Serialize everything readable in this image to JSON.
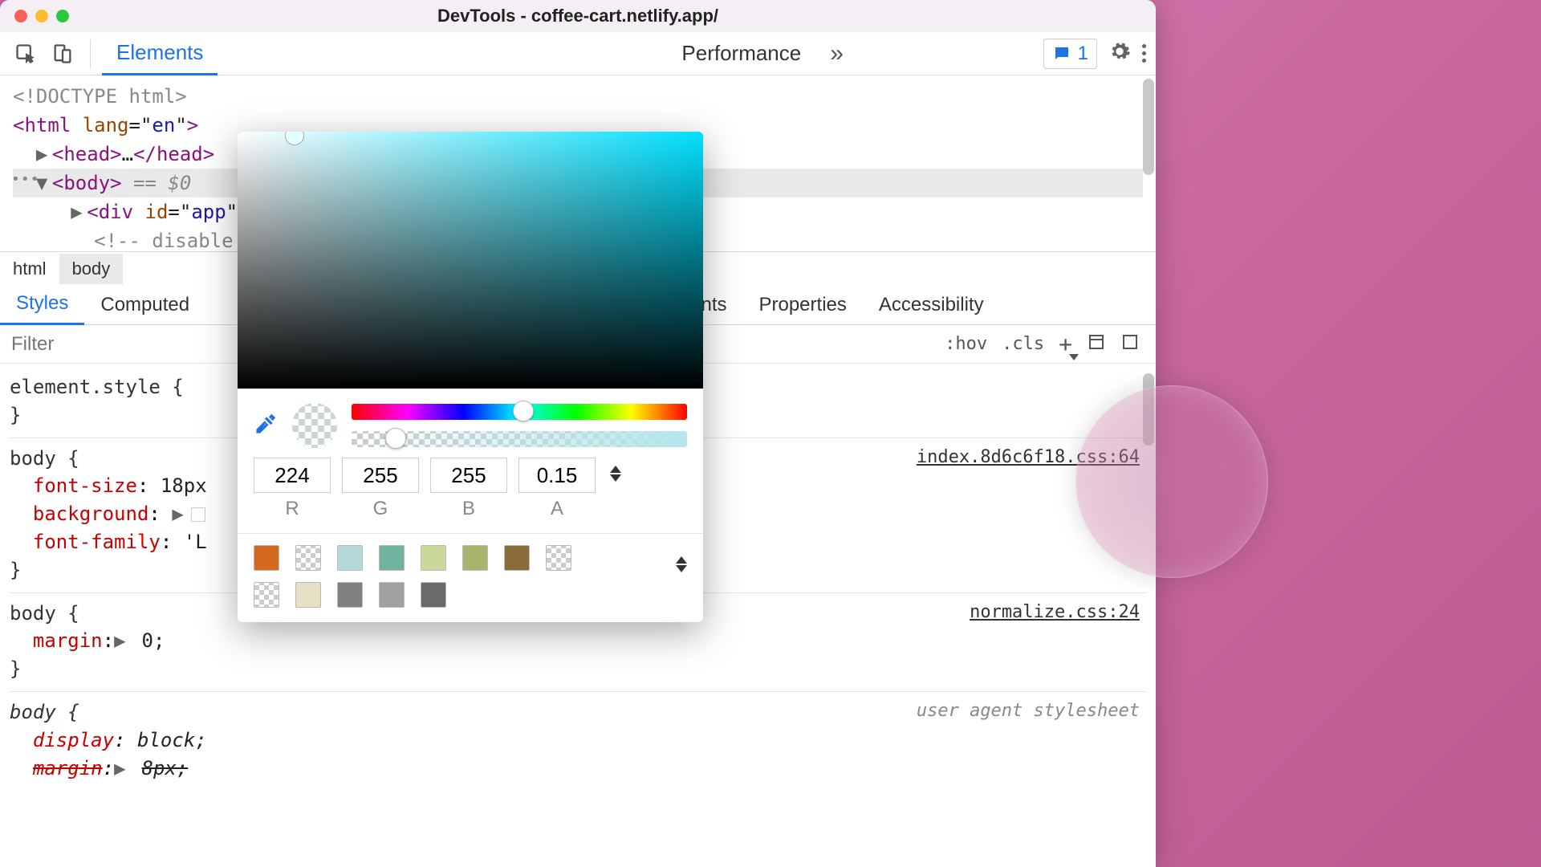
{
  "window": {
    "title": "DevTools - coffee-cart.netlify.app/"
  },
  "toolbar": {
    "tabs": [
      "Elements",
      "Performance"
    ],
    "more_glyph": "»",
    "issue_count": "1"
  },
  "dom": {
    "doctype": "<!DOCTYPE html>",
    "html_open": "<html lang=\"en\">",
    "head": "<head>…</head>",
    "body": "<body>",
    "body_sel": " == $0",
    "div": "<div id=\"app\"",
    "comment": "<!-- disable",
    "comment_close": ">"
  },
  "crumbs": [
    "html",
    "body"
  ],
  "styles": {
    "tabs": [
      "Styles",
      "Computed",
      "akpoints",
      "Properties",
      "Accessibility"
    ],
    "filter_placeholder": "Filter",
    "hov": ":hov",
    "cls": ".cls",
    "rules": [
      {
        "selector": "element.style {",
        "close": "}"
      },
      {
        "selector": "body {",
        "source": "index.8d6c6f18.css:64",
        "lines": [
          {
            "prop": "font-size",
            "val": "18px"
          },
          {
            "prop": "background",
            "expand": true,
            "swatch": true
          },
          {
            "prop": "font-family",
            "val": "'L"
          }
        ],
        "close": "}"
      },
      {
        "selector": "body {",
        "source": "normalize.css:24",
        "lines": [
          {
            "prop": "margin",
            "expand": true,
            "val": "0;"
          }
        ],
        "close": "}"
      },
      {
        "selector_italic": "body {",
        "source_ua": "user agent stylesheet",
        "lines": [
          {
            "prop_i": "display",
            "val_i": "block;"
          },
          {
            "prop_s": "margin",
            "expand": true,
            "val_s": "8px;"
          }
        ]
      }
    ]
  },
  "picker": {
    "r": "224",
    "g": "255",
    "b": "255",
    "a": "0.15",
    "labels": {
      "r": "R",
      "g": "G",
      "b": "B",
      "a": "A"
    },
    "hue_pos": "48%",
    "alpha_pos": "10%",
    "palette": [
      [
        "#d2691e",
        "#ffffff",
        "#b5d8d8",
        "#6fb3a0",
        "#c9d99a",
        "#a8b36c",
        "#8a6b3a",
        "#ffffff"
      ],
      [
        "#ffffff",
        "#e8e0c4",
        "#808080",
        "#a0a0a0",
        "#6a6a6a"
      ]
    ]
  }
}
